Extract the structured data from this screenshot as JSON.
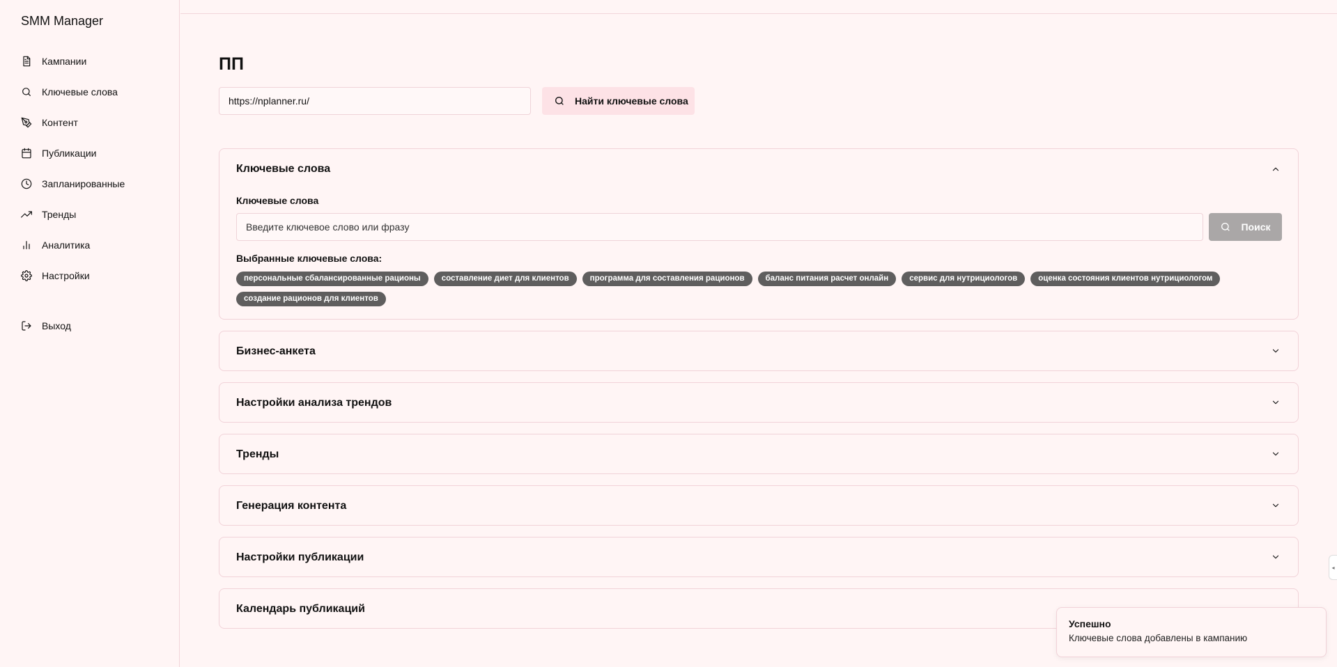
{
  "app": {
    "title": "SMM Manager"
  },
  "sidebar": {
    "items": [
      {
        "label": "Кампании",
        "icon": "document-icon"
      },
      {
        "label": "Ключевые слова",
        "icon": "search-icon"
      },
      {
        "label": "Контент",
        "icon": "pen-icon"
      },
      {
        "label": "Публикации",
        "icon": "calendar-icon"
      },
      {
        "label": "Запланированные",
        "icon": "clock-icon"
      },
      {
        "label": "Тренды",
        "icon": "trending-icon"
      },
      {
        "label": "Аналитика",
        "icon": "bar-chart-icon"
      },
      {
        "label": "Настройки",
        "icon": "gear-icon"
      }
    ],
    "logout": {
      "label": "Выход",
      "icon": "logout-icon"
    }
  },
  "main": {
    "title": "ПП",
    "url_input": {
      "value": "https://nplanner.ru/"
    },
    "find_button": {
      "label": "Найти ключевые слова"
    }
  },
  "keywords_panel": {
    "title": "Ключевые слова",
    "field_label": "Ключевые слова",
    "input_placeholder": "Введите ключевое слово или фразу",
    "search_button": "Поиск",
    "selected_label": "Выбранные ключевые слова:",
    "tags": [
      "персональные сбалансированные рационы",
      "составление диет для клиентов",
      "программа для составления рационов",
      "баланс питания расчет онлайн",
      "сервис для нутрициологов",
      "оценка состояния клиентов нутрициологом",
      "создание рационов для клиентов"
    ]
  },
  "collapsed_panels": [
    {
      "title": "Бизнес-анкета"
    },
    {
      "title": "Настройки анализа трендов"
    },
    {
      "title": "Тренды"
    },
    {
      "title": "Генерация контента"
    },
    {
      "title": "Настройки публикации"
    },
    {
      "title": "Календарь публикаций"
    }
  ],
  "toast": {
    "title": "Успешно",
    "message": "Ключевые слова добавлены в кампанию"
  },
  "colors": {
    "background": "#fff5f5",
    "tag_background": "#5f5e5e",
    "find_button": "#fde2e6",
    "disabled_button": "#aaa7a7",
    "border": "#f1d2d8"
  }
}
